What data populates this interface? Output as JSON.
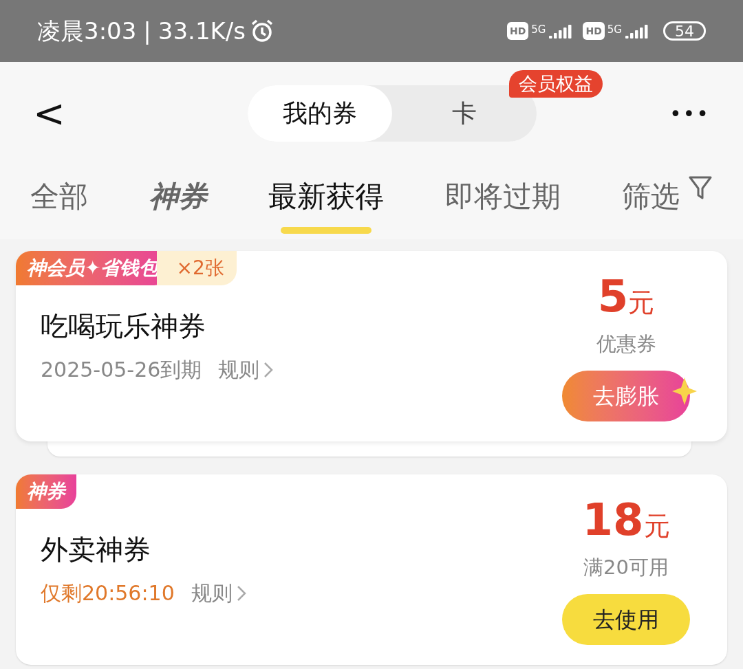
{
  "status_bar": {
    "time": "凌晨3:03",
    "separator": "|",
    "speed": "33.1K/s",
    "sim_labels": [
      "HD",
      "HD"
    ],
    "network_labels": [
      "5G",
      "5G"
    ],
    "battery": "54"
  },
  "header": {
    "back": "<",
    "segments": [
      {
        "label": "我的券",
        "selected": true
      },
      {
        "label": "卡",
        "selected": false
      }
    ],
    "badge": "会员权益",
    "more": "•••"
  },
  "tabs": [
    {
      "label": "全部",
      "kind": "text",
      "selected": false
    },
    {
      "label": "神券",
      "kind": "logo",
      "selected": false
    },
    {
      "label": "最新获得",
      "kind": "text",
      "selected": true
    },
    {
      "label": "即将过期",
      "kind": "text",
      "selected": false
    },
    {
      "label": "筛选",
      "kind": "filter",
      "selected": false
    }
  ],
  "coupons": [
    {
      "tag": "神会员✦省钱包",
      "count": "×2张",
      "stacked": true,
      "title": "吃喝玩乐神券",
      "expiry": "2025-05-26到期",
      "urgent": false,
      "rules": "规则",
      "amount": "5",
      "unit": "元",
      "condition": "优惠券",
      "button": "去膨胀",
      "kind": "boost"
    },
    {
      "tag": "神券",
      "stacked": false,
      "title": "外卖神券",
      "expiry": "仅剩20:56:10",
      "urgent": true,
      "rules": "规则",
      "amount": "18",
      "unit": "元",
      "condition": "满20可用",
      "button": "去使用",
      "kind": "use"
    }
  ]
}
